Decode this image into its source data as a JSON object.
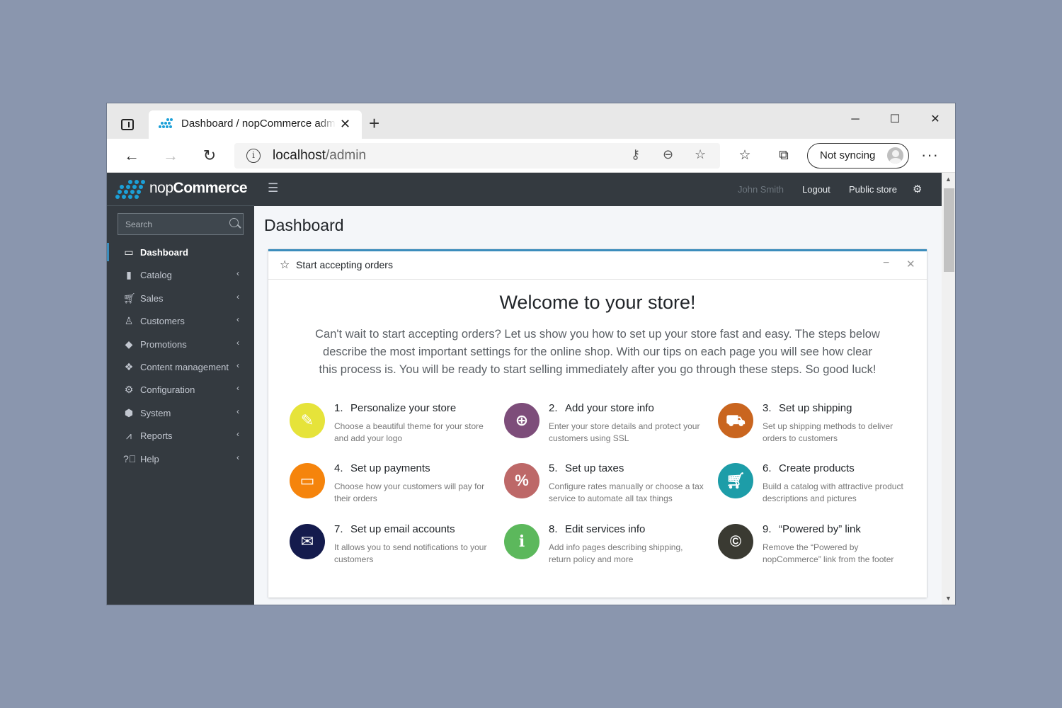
{
  "browser": {
    "tab_title": "Dashboard / nopCommerce administration",
    "new_tab": "+",
    "url_host": "localhost",
    "url_path": "/admin",
    "sync_label": "Not syncing",
    "more": "···"
  },
  "topbar": {
    "user": "John Smith",
    "logout": "Logout",
    "public_store": "Public store"
  },
  "sidebar": {
    "brand_light": "nop",
    "brand_bold": "Commerce",
    "search_placeholder": "Search",
    "items": [
      {
        "label": "Dashboard",
        "icon": "monitor-icon",
        "active": true
      },
      {
        "label": "Catalog",
        "icon": "book-icon"
      },
      {
        "label": "Sales",
        "icon": "cart-icon"
      },
      {
        "label": "Customers",
        "icon": "user-icon"
      },
      {
        "label": "Promotions",
        "icon": "tags-icon"
      },
      {
        "label": "Content management",
        "icon": "cubes-icon"
      },
      {
        "label": "Configuration",
        "icon": "gears-icon"
      },
      {
        "label": "System",
        "icon": "cube-icon"
      },
      {
        "label": "Reports",
        "icon": "chart-icon"
      },
      {
        "label": "Help",
        "icon": "question-icon"
      }
    ]
  },
  "page": {
    "title": "Dashboard",
    "card_title": "Start accepting orders",
    "welcome": "Welcome to your store!",
    "intro": "Can't wait to start accepting orders? Let us show you how to set up your store fast and easy. The steps below describe the most important settings for the online shop. With our tips on each page you will see how clear this process is. You will be ready to start selling immediately after you go through these steps. So good luck!"
  },
  "steps": [
    {
      "num": "1.",
      "title": "Personalize your store",
      "desc": "Choose a beautiful theme for your store and add your logo",
      "color": "#e6e33a",
      "icon": "pencil-icon"
    },
    {
      "num": "2.",
      "title": "Add your store info",
      "desc": "Enter your store details and protect your customers using SSL",
      "color": "#7d4d7a",
      "icon": "globe-icon"
    },
    {
      "num": "3.",
      "title": "Set up shipping",
      "desc": "Set up shipping methods to deliver orders to customers",
      "color": "#c9651f",
      "icon": "truck-icon"
    },
    {
      "num": "4.",
      "title": "Set up payments",
      "desc": "Choose how your customers will pay for their orders",
      "color": "#f5840c",
      "icon": "credit-card-icon"
    },
    {
      "num": "5.",
      "title": "Set up taxes",
      "desc": "Configure rates manually or choose a tax service to automate all tax things",
      "color": "#bd6868",
      "icon": "percent-icon"
    },
    {
      "num": "6.",
      "title": "Create products",
      "desc": "Build a catalog with attractive product descriptions and pictures",
      "color": "#1d9da8",
      "icon": "cart-icon"
    },
    {
      "num": "7.",
      "title": "Set up email accounts",
      "desc": "It allows you to send notifications to your customers",
      "color": "#141b4d",
      "icon": "envelope-icon"
    },
    {
      "num": "8.",
      "title": "Edit services info",
      "desc": "Add info pages describing shipping, return policy and more",
      "color": "#5cb85c",
      "icon": "info-icon"
    },
    {
      "num": "9.",
      "title": "“Powered by” link",
      "desc": "Remove the “Powered by nopCommerce” link from the footer",
      "color": "#3a3a32",
      "icon": "copyright-icon"
    }
  ]
}
